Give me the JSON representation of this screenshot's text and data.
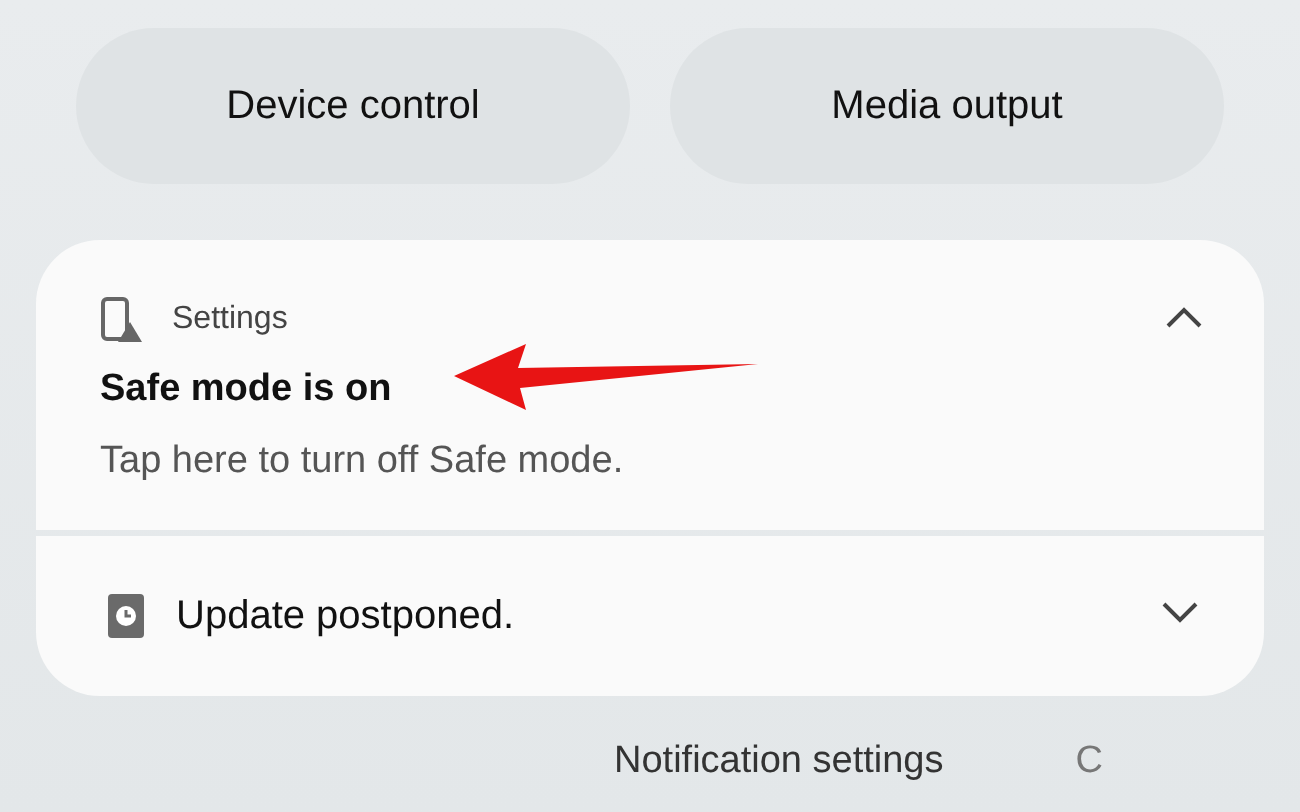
{
  "quick_buttons": [
    {
      "label": "Device control"
    },
    {
      "label": "Media output"
    }
  ],
  "notifications": [
    {
      "kind": "app",
      "app": "Settings",
      "title": "Safe mode is on",
      "body": "Tap here to turn off Safe mode.",
      "expanded": true
    },
    {
      "kind": "simple",
      "title": "Update postponed.",
      "expanded": false
    }
  ],
  "footer": [
    {
      "label": "Notification settings"
    },
    {
      "label": "C"
    }
  ]
}
